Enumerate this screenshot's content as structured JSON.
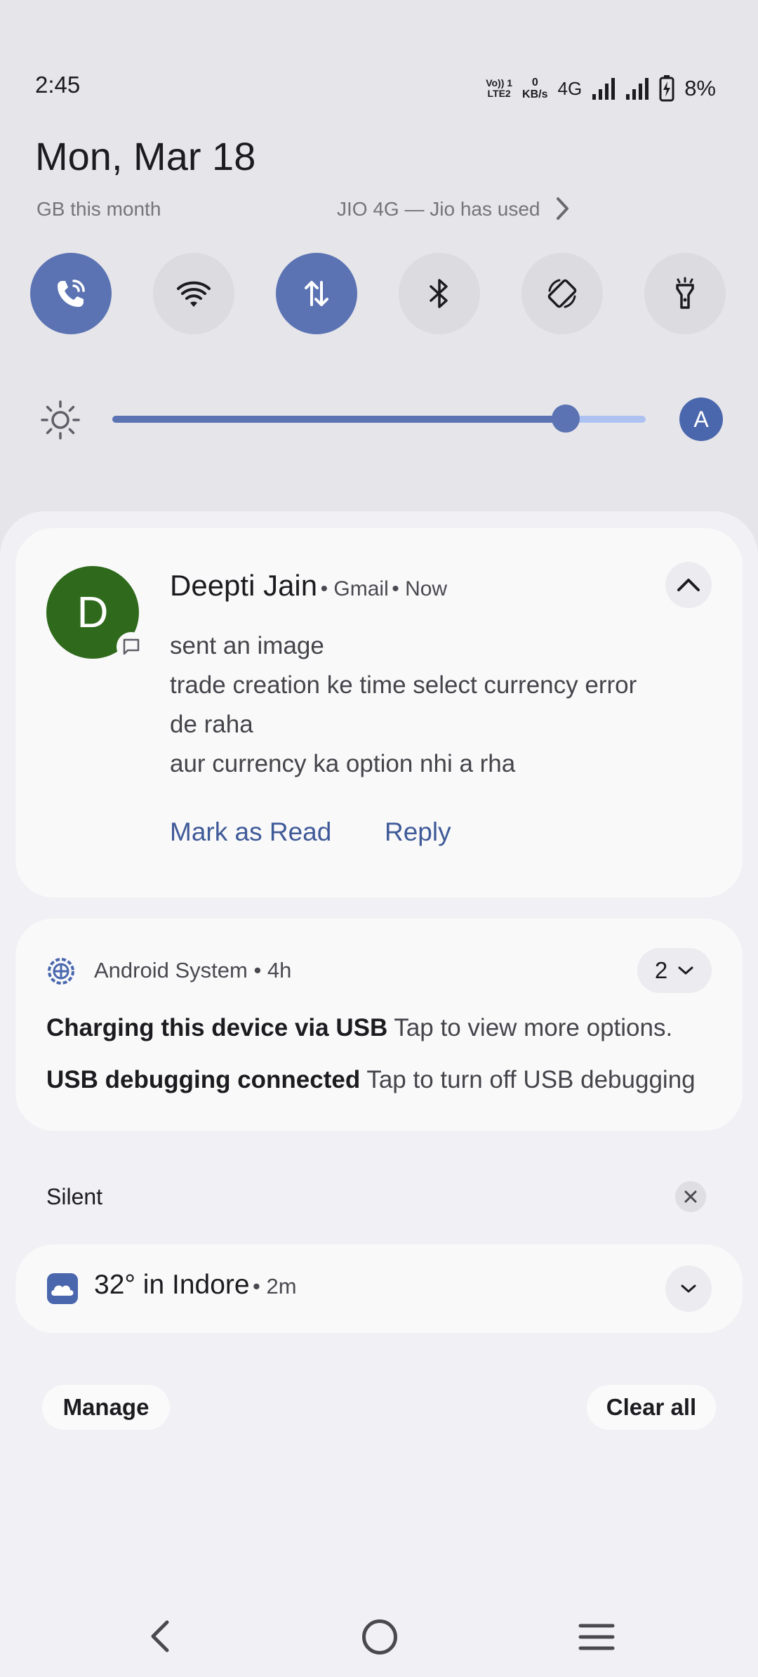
{
  "status_bar": {
    "time": "2:45",
    "volte_top": "Vo)) 1",
    "volte_bottom": "LTE2",
    "speed_value": "0",
    "speed_unit": "KB/s",
    "network_type": "4G",
    "battery": "8%"
  },
  "header": {
    "date": "Mon, Mar 18",
    "data_usage": "GB this month",
    "network_info": "JIO 4G — Jio has used"
  },
  "quick_tiles": [
    {
      "icon": "wifi-calling-icon",
      "active": true
    },
    {
      "icon": "wifi-icon",
      "active": false
    },
    {
      "icon": "mobile-data-icon",
      "active": true
    },
    {
      "icon": "bluetooth-icon",
      "active": false
    },
    {
      "icon": "auto-rotate-icon",
      "active": false
    },
    {
      "icon": "flashlight-icon",
      "active": false
    }
  ],
  "brightness": {
    "level": 0.85,
    "auto_label": "A"
  },
  "gmail_notification": {
    "avatar_letter": "D",
    "sender": "Deepti Jain",
    "app": "Gmail",
    "time": "Now",
    "lines": [
      "sent an image",
      "trade creation ke time select currency error",
      "de raha",
      "aur currency ka option nhi a rha"
    ],
    "actions": {
      "mark_read": "Mark as Read",
      "reply": "Reply"
    }
  },
  "system_notification": {
    "app": "Android System",
    "time": "4h",
    "count": "2",
    "items": [
      {
        "title": "Charging this device via USB",
        "text": "Tap to view more options."
      },
      {
        "title": "USB debugging connected",
        "text": "Tap to turn off USB debugging"
      }
    ]
  },
  "silent_section": {
    "label": "Silent"
  },
  "weather_notification": {
    "title": "32° in Indore",
    "time": "2m"
  },
  "buttons": {
    "manage": "Manage",
    "clear_all": "Clear all"
  },
  "colors": {
    "accent": "#5b73b3",
    "tile_inactive": "#dbdbe0",
    "avatar": "#2f6a1c",
    "action_text": "#3f5a98"
  }
}
